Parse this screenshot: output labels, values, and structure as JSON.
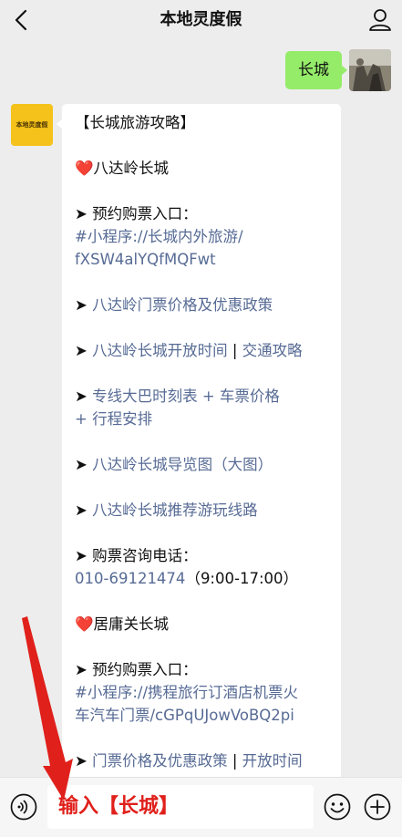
{
  "header": {
    "title": "本地灵度假",
    "back_icon": "chevron-left-icon",
    "profile_icon": "person-icon"
  },
  "chat": {
    "user_message": "长城",
    "bot_avatar_text": "本地灵度假",
    "bot_message": {
      "title": "【长城旅游攻略】",
      "section1_heading": "八达岭长城",
      "s1_booking_label": "预约购票入口：",
      "s1_booking_link_line1": "#小程序://长城内外旅游/",
      "s1_booking_link_line2": "fXSW4alYQfMQFwt",
      "s1_link_price": "八达岭门票价格及优惠政策",
      "s1_link_hours": "八达岭长城开放时间",
      "s1_link_traffic": "交通攻略",
      "s1_link_bus_line1": "专线大巴时刻表 + 车票价格",
      "s1_link_bus_line2": "+ 行程安排",
      "s1_link_map": "八达岭长城导览图（大图）",
      "s1_link_route": "八达岭长城推荐游玩线路",
      "s1_phone_label": "购票咨询电话：",
      "s1_phone_number": "010-69121474",
      "s1_phone_hours": "（9:00-17:00）",
      "section2_heading": "居庸关长城",
      "s2_booking_label": "预约购票入口：",
      "s2_booking_link_line1": "#小程序://携程旅行订酒店机票火",
      "s2_booking_link_line2": "车汽车门票/cGPqUJowVoBQ2pi",
      "s2_link_price": "门票价格及优惠政策",
      "s2_link_hours": "开放时间",
      "separator": "|",
      "heart": "❤️",
      "arrow": "➤"
    }
  },
  "input_bar": {
    "input_value": "输入【长城】",
    "voice_icon": "voice-icon",
    "emoji_icon": "emoji-icon",
    "plus_icon": "plus-icon"
  },
  "colors": {
    "link": "#576b95",
    "bubble_green": "#95ec69",
    "annotation_red": "#e0201b"
  }
}
